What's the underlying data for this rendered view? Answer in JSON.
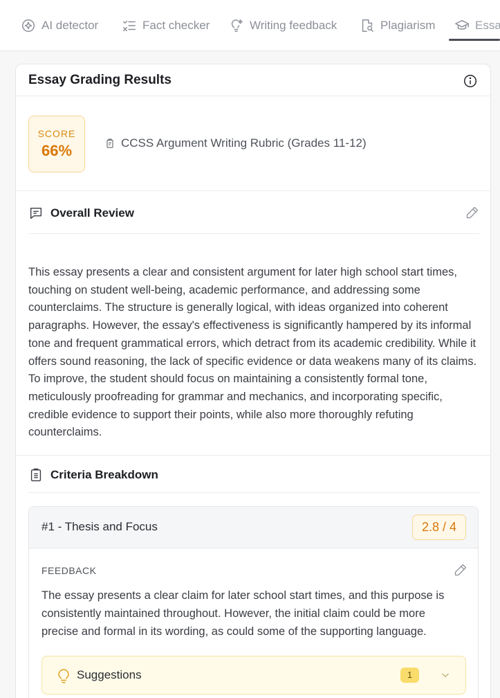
{
  "tabs": [
    {
      "label": "AI detector",
      "icon": "ai-detector-icon"
    },
    {
      "label": "Fact checker",
      "icon": "checklist-icon"
    },
    {
      "label": "Writing feedback",
      "icon": "lightbulb-icon"
    },
    {
      "label": "Plagiarism",
      "icon": "document-search-icon"
    },
    {
      "label": "Essa",
      "icon": "graduation-cap-icon",
      "active": true
    }
  ],
  "card": {
    "title": "Essay Grading Results",
    "score_label": "SCORE",
    "score_value": "66%",
    "rubric": "CCSS Argument Writing Rubric (Grades 11-12)"
  },
  "overall_review": {
    "heading": "Overall Review",
    "text": "This essay presents a clear and consistent argument for later high school start times, touching on student well-being, academic performance, and addressing some counterclaims. The structure is generally logical, with ideas organized into coherent paragraphs. However, the essay's effectiveness is significantly hampered by its informal tone and frequent grammatical errors, which detract from its academic credibility. While it offers sound reasoning, the lack of specific evidence or data weakens many of its claims. To improve, the student should focus on maintaining a consistently formal tone, meticulously proofreading for grammar and mechanics, and incorporating specific, credible evidence to support their points, while also more thoroughly refuting counterclaims."
  },
  "criteria": {
    "heading": "Criteria Breakdown",
    "items": [
      {
        "title": "#1 - Thesis and Focus",
        "score": "2.8 / 4",
        "feedback_label": "FEEDBACK",
        "feedback": "The essay presents a clear claim for later school start times, and this purpose is consistently maintained throughout. However, the initial claim could be more precise and formal in its wording, as could some of the supporting language.",
        "suggestions_label": "Suggestions",
        "suggestions_count": "1"
      }
    ]
  },
  "colors": {
    "accent": "#d9780a",
    "score_bg": "#fff8e8",
    "suggest_bg": "#fffbe8",
    "badge": "#f9dc6b"
  }
}
